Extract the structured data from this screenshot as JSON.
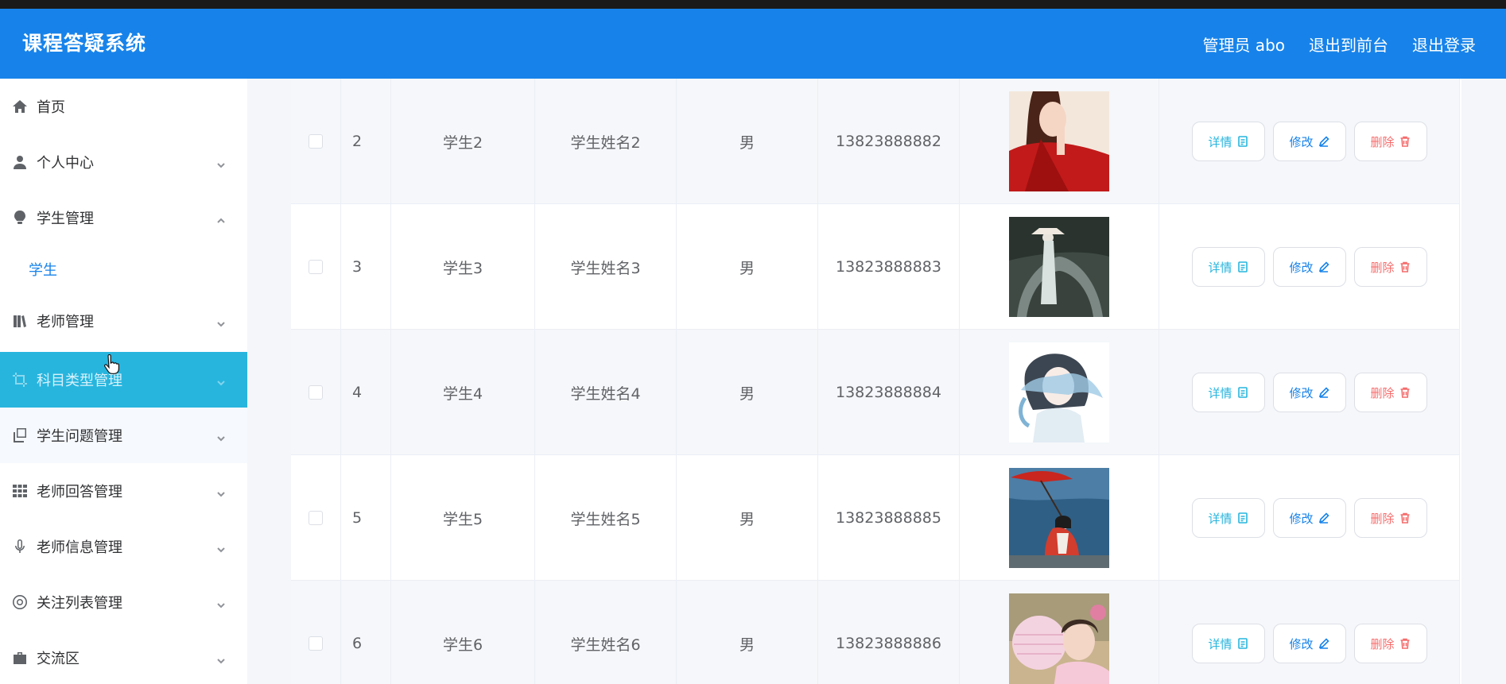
{
  "header": {
    "brand": "课程答疑系统",
    "user_label": "管理员 abo",
    "to_front_label": "退出到前台",
    "logout_label": "退出登录"
  },
  "sidebar": {
    "items": [
      {
        "label": "首页",
        "icon": "home-icon"
      },
      {
        "label": "个人中心",
        "icon": "user-icon"
      },
      {
        "label": "学生管理",
        "icon": "bulb-icon",
        "expanded": true,
        "children": [
          {
            "label": "学生"
          }
        ]
      },
      {
        "label": "老师管理",
        "icon": "books-icon"
      },
      {
        "label": "科目类型管理",
        "icon": "crop-icon",
        "highlighted": true
      },
      {
        "label": "学生问题管理",
        "icon": "copy-icon"
      },
      {
        "label": "老师回答管理",
        "icon": "grid-icon"
      },
      {
        "label": "老师信息管理",
        "icon": "mic-icon"
      },
      {
        "label": "关注列表管理",
        "icon": "lifebuoy-icon"
      },
      {
        "label": "交流区",
        "icon": "briefcase-icon"
      }
    ]
  },
  "table": {
    "buttons": {
      "detail": "详情",
      "edit": "修改",
      "delete": "删除"
    },
    "rows": [
      {
        "index": "2",
        "account": "学生2",
        "name": "学生姓名2",
        "gender": "男",
        "phone": "13823888882",
        "photo": "woman-red-robe-illustration"
      },
      {
        "index": "3",
        "account": "学生3",
        "name": "学生姓名3",
        "gender": "男",
        "phone": "13823888883",
        "photo": "figure-on-stone-bridge"
      },
      {
        "index": "4",
        "account": "学生4",
        "name": "学生姓名4",
        "gender": "男",
        "phone": "13823888884",
        "photo": "watercolor-portrait"
      },
      {
        "index": "5",
        "account": "学生5",
        "name": "学生姓名5",
        "gender": "男",
        "phone": "13823888885",
        "photo": "girl-with-red-umbrella-by-lake"
      },
      {
        "index": "6",
        "account": "学生6",
        "name": "学生姓名6",
        "gender": "男",
        "phone": "13823888886",
        "photo": "girl-with-pink-lantern"
      }
    ]
  },
  "colors": {
    "header_bg": "#1783ea",
    "active_menu_bg": "#27b5de",
    "submenu_text": "#1783ea",
    "detail": "#27b5de",
    "edit": "#1783ea",
    "delete": "#f56c6c"
  }
}
